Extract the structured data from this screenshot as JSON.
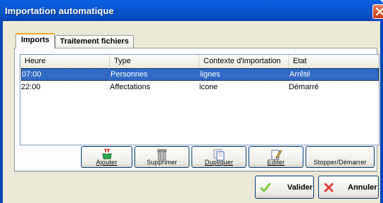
{
  "window": {
    "title": "Importation automatique"
  },
  "tabs": [
    {
      "label": "Imports",
      "active": true
    },
    {
      "label": "Traitement fichiers",
      "active": false
    }
  ],
  "table": {
    "columns": [
      "Heure",
      "Type",
      "Contexte d'importation",
      "Etat"
    ],
    "rows": [
      {
        "heure": "07:00",
        "type": "Personnes",
        "contexte": "lignes",
        "etat": "Arrêté",
        "selected": true
      },
      {
        "heure": "22:00",
        "type": "Affectations",
        "contexte": "icone",
        "etat": "Démarré",
        "selected": false
      }
    ]
  },
  "toolbar": {
    "add_label": "Ajouter",
    "delete_label": "Supprimer",
    "duplicate_label": "Dupliquer",
    "edit_label": "Editer",
    "startstop_label": "Stopper/Démarrer"
  },
  "dialog": {
    "ok_label": "Valider",
    "cancel_label": "Annuler"
  },
  "colors": {
    "titlebar": "#0a58d6",
    "selection": "#316ac5",
    "tab_highlight": "#f5a623",
    "valider_check": "#7ac943",
    "annuler_x": "#e0403a"
  },
  "icons": {
    "close": "close-icon",
    "add": "add-icon",
    "delete": "trash-icon",
    "duplicate": "duplicate-icon",
    "edit": "edit-icon",
    "ok": "check-icon",
    "cancel": "x-icon"
  }
}
